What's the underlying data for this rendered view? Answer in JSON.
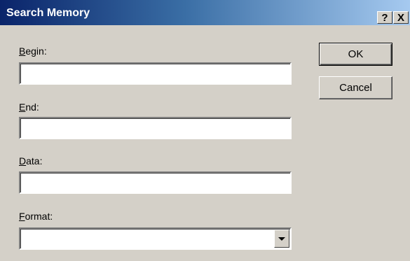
{
  "window": {
    "title": "Search Memory",
    "help_label": "?",
    "close_label": "X"
  },
  "form": {
    "begin": {
      "label_accel": "B",
      "label_rest": "egin:",
      "value": ""
    },
    "end": {
      "label_accel": "E",
      "label_rest": "nd:",
      "value": ""
    },
    "data": {
      "label_accel": "D",
      "label_rest": "ata:",
      "value": ""
    },
    "format": {
      "label_accel": "F",
      "label_rest": "ormat:",
      "selected": ""
    }
  },
  "buttons": {
    "ok_label": "OK",
    "cancel_label": "Cancel"
  },
  "colors": {
    "dialog_face": "#d4d0c8",
    "title_active_start": "#0a246a",
    "title_active_end": "#a6caf0"
  }
}
